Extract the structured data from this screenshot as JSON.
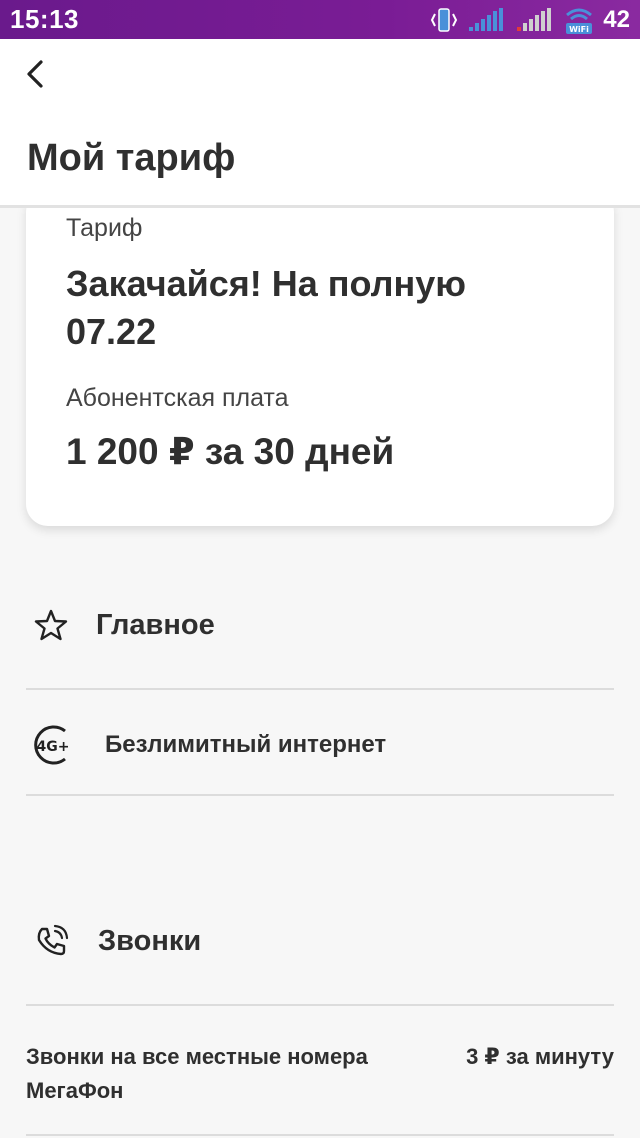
{
  "status_bar": {
    "time": "15:13",
    "battery": "42",
    "wifi_label": "WiFi"
  },
  "header": {
    "title": "Мой тариф"
  },
  "tariff_card": {
    "tariff_label": "Тариф",
    "tariff_name": "Закачайся! На полную 07.22",
    "fee_label": "Абонентская плата",
    "fee_value": "1 200 ₽ за 30 дней"
  },
  "sections": {
    "main": {
      "title": "Главное",
      "icon": "star-icon"
    },
    "internet": {
      "title": "Безлимитный интернет",
      "icon": "4g-plus-icon",
      "icon_text": "4G+"
    },
    "calls": {
      "title": "Звонки",
      "icon": "phone-ringing-icon"
    }
  },
  "calls_items": [
    {
      "name": "Звонки на все местные номера МегаФон",
      "price": "3 ₽ за минуту"
    }
  ],
  "colors": {
    "status_bar": "#7a1c95",
    "text": "#2f2f2f"
  }
}
